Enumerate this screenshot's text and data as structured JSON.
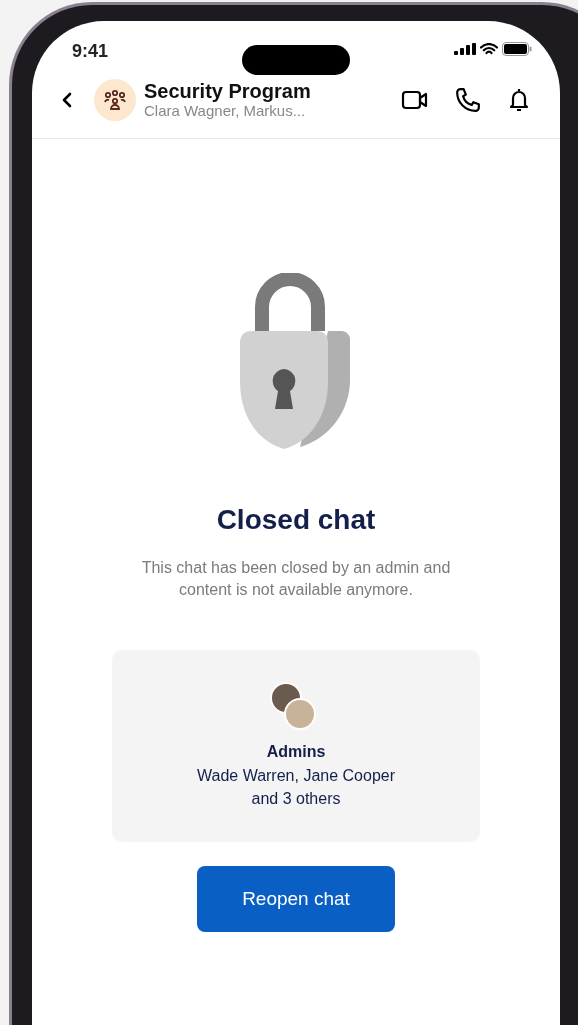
{
  "status_bar": {
    "time": "9:41"
  },
  "header": {
    "title": "Security Program",
    "subtitle": "Clara Wagner, Markus..."
  },
  "notice": {
    "title": "Closed chat",
    "description": "This chat has been closed by an admin and content is not available anymore."
  },
  "admins": {
    "label": "Admins",
    "names": "Wade Warren, Jane Cooper",
    "more": "and 3 others"
  },
  "button": {
    "label": "Reopen chat"
  }
}
